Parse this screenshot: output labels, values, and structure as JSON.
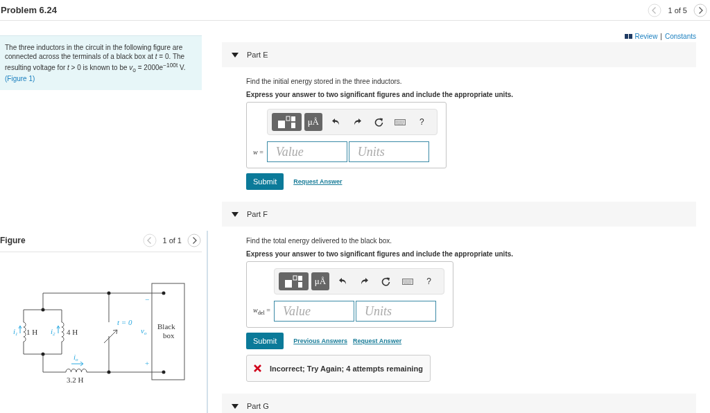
{
  "header": {
    "title": "Problem 6.24",
    "pager": "1 of 5"
  },
  "intro": {
    "text": "The three inductors in the circuit in the following figure are connected across the terminals of a black box at *t* = 0. The resulting voltage for *t* > 0 is known to be *v*$_{o}$ = 2000e$^{−100t}$ V.",
    "figure_link": "(Figure 1)"
  },
  "figure": {
    "label": "Figure",
    "pager": "1 of 1",
    "labels": [
      {
        "kind": "current",
        "symbol": "i",
        "subscript": "1"
      },
      {
        "kind": "value",
        "text": "1 H"
      },
      {
        "kind": "current",
        "symbol": "i",
        "subscript": "2"
      },
      {
        "kind": "value",
        "text": "4 H"
      },
      {
        "kind": "switch",
        "text": "t = 0"
      },
      {
        "kind": "voltage",
        "symbol": "v",
        "subscript": "o"
      },
      {
        "kind": "sign",
        "text": "−"
      },
      {
        "kind": "sign",
        "text": "+"
      },
      {
        "kind": "box",
        "text": "Black"
      },
      {
        "kind": "box",
        "text": "box"
      },
      {
        "kind": "current",
        "symbol": "i",
        "subscript": "o"
      },
      {
        "kind": "value",
        "text": "3.2 H"
      }
    ]
  },
  "resources": {
    "review": "Review",
    "separator": "|",
    "constants": "Constants"
  },
  "parts": [
    {
      "title": "Part E",
      "prompt": "Find the initial energy stored in the three inductors.",
      "instruction": "Express your answer to two significant figures and include the appropriate units.",
      "variable": "*w* =",
      "unit_button": "μÅ",
      "help": "?",
      "value_placeholder": "Value",
      "units_placeholder": "Units",
      "submit": "Submit",
      "links": [
        "Request Answer"
      ]
    },
    {
      "title": "Part F",
      "prompt": "Find the total energy delivered to the black box.",
      "instruction": "Express your answer to two significant figures and include the appropriate units.",
      "variable": "*w*$_{del}$ =",
      "unit_button": "μÅ",
      "help": "?",
      "value_placeholder": "Value",
      "units_placeholder": "Units",
      "submit": "Submit",
      "links": [
        "Previous Answers",
        "Request Answer"
      ],
      "feedback": "Incorrect; Try Again; 4 attempts remaining"
    },
    {
      "title": "Part G"
    }
  ]
}
